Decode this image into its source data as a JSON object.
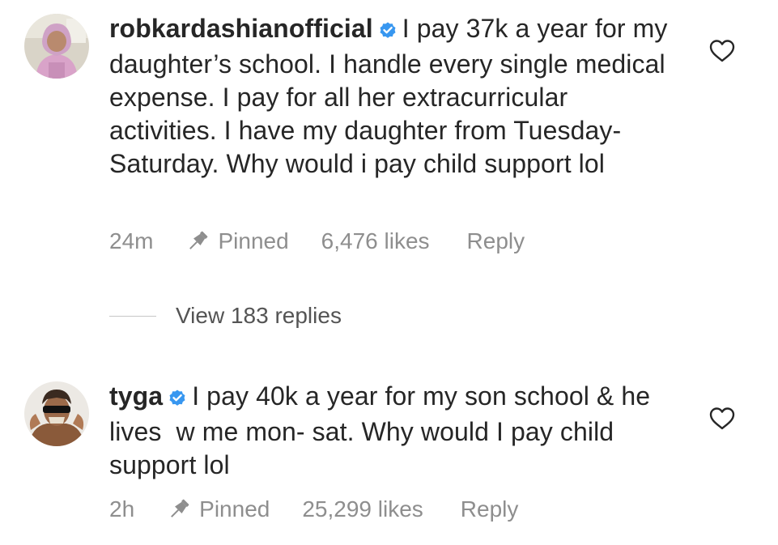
{
  "comments": [
    {
      "username": "robkardashianofficial",
      "text": "I pay 37k a year for my daughter’s school. I handle every single medical expense. I pay for all her extracurricular activities. I have my daughter from Tuesday-Saturday. Why would i pay child support lol",
      "time": "24m",
      "pinned_label": "Pinned",
      "likes": "6,476 likes",
      "reply_label": "Reply",
      "view_replies": "View 183 replies"
    },
    {
      "username": "tyga",
      "text": "I pay 40k a year for my son school & he lives  w me mon- sat. Why would I pay child support lol",
      "time": "2h",
      "pinned_label": "Pinned",
      "likes": "25,299 likes",
      "reply_label": "Reply"
    }
  ],
  "colors": {
    "text": "#262626",
    "meta": "#8e8e8e",
    "verified": "#3897f0"
  },
  "icons": [
    "verified-badge-icon",
    "heart-icon",
    "pin-icon"
  ]
}
